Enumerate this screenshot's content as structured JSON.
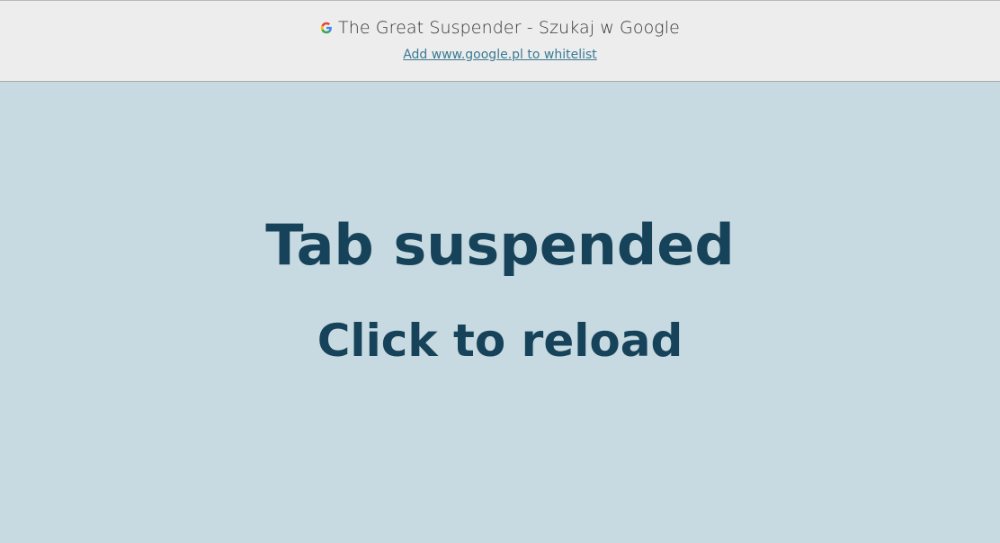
{
  "header": {
    "favicon": "google-g-icon",
    "tab_title": "The Great Suspender - Szukaj w Google",
    "whitelist_link": "Add www.google.pl to whitelist"
  },
  "main": {
    "heading": "Tab suspended",
    "subheading": "Click to reload"
  },
  "colors": {
    "header_bg": "#ededed",
    "page_bg": "#c8dae1",
    "heading_text": "#16435a",
    "link": "#3a7a93"
  }
}
